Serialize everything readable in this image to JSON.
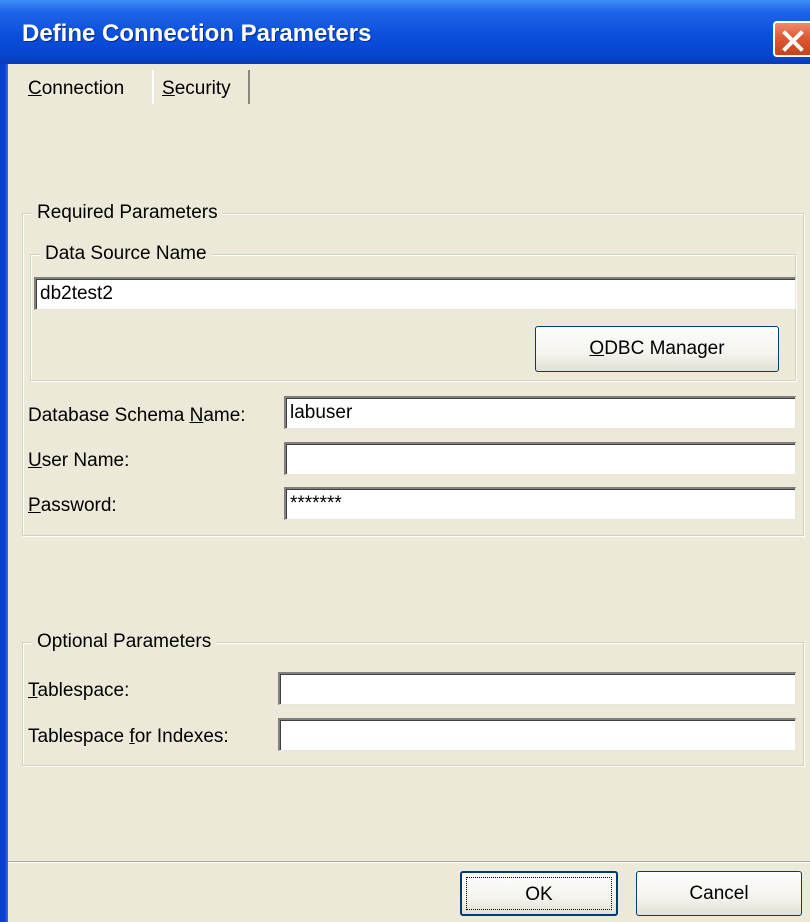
{
  "window": {
    "title": "Define Connection Parameters"
  },
  "tabs": [
    {
      "label": "Connection",
      "accel": "C",
      "rest": "onnection",
      "selected": true
    },
    {
      "label": "Security",
      "accel": "S",
      "rest": "ecurity",
      "selected": false
    }
  ],
  "required": {
    "title": "Required Parameters",
    "dsn_group_title": "Data Source Name",
    "dsn_value": "db2test2",
    "odbc_button": {
      "accel": "O",
      "rest": "DBC Manager"
    },
    "schema": {
      "pre": "Database Schema ",
      "accel": "N",
      "post": "ame:",
      "value": "labuser"
    },
    "user": {
      "pre": "",
      "accel": "U",
      "post": "ser Name:",
      "value": ""
    },
    "password": {
      "pre": "",
      "accel": "P",
      "post": "assword:",
      "value": "*******"
    }
  },
  "optional": {
    "title": "Optional Parameters",
    "tablespace": {
      "pre": "",
      "accel": "T",
      "post": "ablespace:",
      "value": ""
    },
    "tablespace_indexes": {
      "pre": "Tablespace ",
      "accel": "f",
      "post": "or Indexes:",
      "value": ""
    }
  },
  "buttons": {
    "ok": "OK",
    "cancel": "Cancel"
  },
  "colors": {
    "title_bar": "#0a4fdc",
    "dialog_bg": "#ece9d8",
    "close_button": "#e05a36"
  }
}
